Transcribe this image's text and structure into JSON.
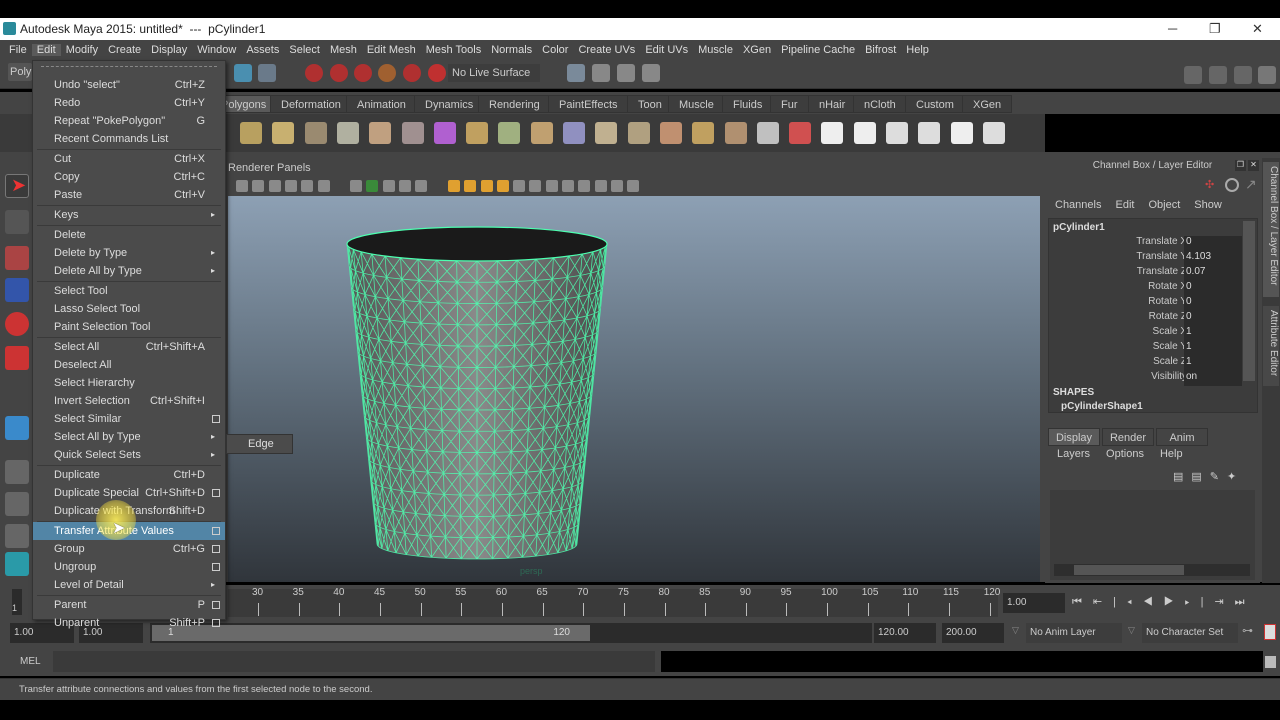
{
  "window": {
    "title": "Autodesk Maya 2015: untitled*  ---  pCylinder1",
    "minimize": "─",
    "restore": "❐",
    "close": "✕"
  },
  "menubar": [
    "File",
    "Edit",
    "Modify",
    "Create",
    "Display",
    "Window",
    "Assets",
    "Select",
    "Mesh",
    "Edit Mesh",
    "Mesh Tools",
    "Normals",
    "Color",
    "Create UVs",
    "Edit UVs",
    "Muscle",
    "XGen",
    "Pipeline Cache",
    "Bifrost",
    "Help"
  ],
  "toolbar": {
    "mode": "Poly",
    "live_surface": "No Live Surface"
  },
  "shelf_tabs": [
    "Polygons",
    "Deformation",
    "Animation",
    "Dynamics",
    "Rendering",
    "PaintEffects",
    "Toon",
    "Muscle",
    "Fluids",
    "Fur",
    "nHair",
    "nCloth",
    "Custom",
    "XGen"
  ],
  "panel_menu": [
    "Renderer",
    "Panels"
  ],
  "viewport": {
    "camera_label": "persp"
  },
  "edit_menu": {
    "items": [
      {
        "label": "Undo \"select\"",
        "shortcut": "Ctrl+Z"
      },
      {
        "label": "Redo",
        "shortcut": "Ctrl+Y"
      },
      {
        "label": "Repeat \"PokePolygon\"",
        "shortcut": "G"
      },
      {
        "label": "Recent Commands List",
        "shortcut": ""
      },
      {
        "sep": true
      },
      {
        "label": "Cut",
        "shortcut": "Ctrl+X"
      },
      {
        "label": "Copy",
        "shortcut": "Ctrl+C"
      },
      {
        "label": "Paste",
        "shortcut": "Ctrl+V"
      },
      {
        "sep": true
      },
      {
        "label": "Keys",
        "shortcut": "",
        "submenu": true
      },
      {
        "sep": true
      },
      {
        "label": "Delete",
        "shortcut": ""
      },
      {
        "label": "Delete by Type",
        "shortcut": "",
        "submenu": true
      },
      {
        "label": "Delete All by Type",
        "shortcut": "",
        "submenu": true
      },
      {
        "sep": true
      },
      {
        "label": "Select Tool",
        "shortcut": ""
      },
      {
        "label": "Lasso Select Tool",
        "shortcut": ""
      },
      {
        "label": "Paint Selection Tool",
        "shortcut": ""
      },
      {
        "sep": true
      },
      {
        "label": "Select All",
        "shortcut": "Ctrl+Shift+A"
      },
      {
        "label": "Deselect All",
        "shortcut": ""
      },
      {
        "label": "Select Hierarchy",
        "shortcut": ""
      },
      {
        "label": "Invert Selection",
        "shortcut": "Ctrl+Shift+I"
      },
      {
        "label": "Select Similar",
        "shortcut": "",
        "option": true
      },
      {
        "label": "Select All by Type",
        "shortcut": "",
        "submenu": true
      },
      {
        "label": "Quick Select Sets",
        "shortcut": "",
        "submenu": true
      },
      {
        "sep": true
      },
      {
        "label": "Duplicate",
        "shortcut": "Ctrl+D"
      },
      {
        "label": "Duplicate Special",
        "shortcut": "Ctrl+Shift+D",
        "option": true
      },
      {
        "label": "Duplicate with Transform",
        "shortcut": "Shift+D"
      },
      {
        "sep": true
      },
      {
        "label": "Transfer Attribute Values",
        "shortcut": "",
        "option": true,
        "highlighted": true
      },
      {
        "label": "Group",
        "shortcut": "Ctrl+G",
        "option": true
      },
      {
        "label": "Ungroup",
        "shortcut": "",
        "option": true
      },
      {
        "label": "Level of Detail",
        "shortcut": "",
        "submenu": true
      },
      {
        "sep": true
      },
      {
        "label": "Parent",
        "shortcut": "P",
        "option": true
      },
      {
        "label": "Unparent",
        "shortcut": "Shift+P",
        "option": true
      }
    ]
  },
  "submenu": {
    "label": "Edge"
  },
  "channel_box": {
    "title": "Channel Box / Layer Editor",
    "menus": [
      "Channels",
      "Edit",
      "Object",
      "Show"
    ],
    "object": "pCylinder1",
    "channels": [
      {
        "name": "Translate X",
        "value": "0"
      },
      {
        "name": "Translate Y",
        "value": "4.103"
      },
      {
        "name": "Translate Z",
        "value": "0.07"
      },
      {
        "name": "Rotate X",
        "value": "0"
      },
      {
        "name": "Rotate Y",
        "value": "0"
      },
      {
        "name": "Rotate Z",
        "value": "0"
      },
      {
        "name": "Scale X",
        "value": "1"
      },
      {
        "name": "Scale Y",
        "value": "1"
      },
      {
        "name": "Scale Z",
        "value": "1"
      },
      {
        "name": "Visibility",
        "value": "on"
      }
    ],
    "shapes_header": "SHAPES",
    "shape": "pCylinderShape1",
    "layer_tabs": [
      "Display",
      "Render",
      "Anim"
    ],
    "layer_menus": [
      "Layers",
      "Options",
      "Help"
    ]
  },
  "side_tabs": [
    "Channel Box / Layer Editor",
    "Attribute Editor"
  ],
  "timeline": {
    "ticks": [
      30,
      35,
      40,
      45,
      50,
      55,
      60,
      65,
      70,
      75,
      80,
      85,
      90,
      95,
      100,
      105,
      110,
      115,
      120
    ],
    "current_frame": "1.00",
    "left_frame": "1"
  },
  "range": {
    "start": "1.00",
    "playback_start": "1.00",
    "slider_start": "1",
    "slider_end": "120",
    "playback_end": "120.00",
    "end": "200.00",
    "anim_layer": "No Anim Layer",
    "character_set": "No Character Set"
  },
  "command_line": {
    "label": "MEL"
  },
  "help_line": "Transfer attribute connections and values from the first selected node to the second."
}
